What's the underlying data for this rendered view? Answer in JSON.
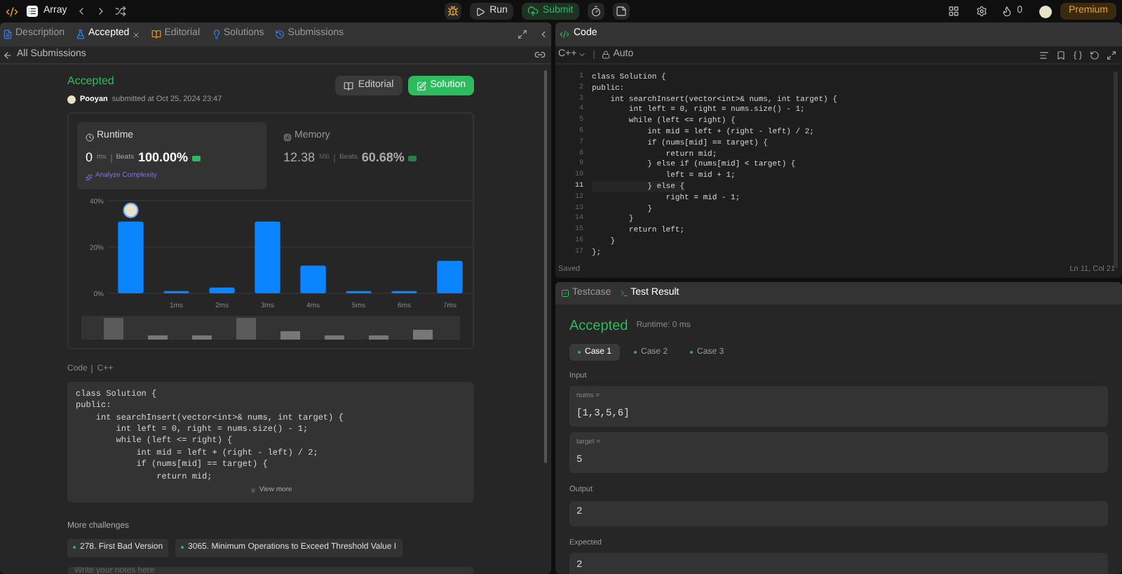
{
  "top_bar": {
    "problem_list": "Array",
    "run": "Run",
    "submit": "Submit",
    "streak": "0",
    "premium": "Premium"
  },
  "left_tabs": [
    {
      "label": "Description",
      "selected": false,
      "closable": false
    },
    {
      "label": "Accepted",
      "selected": true,
      "closable": true
    },
    {
      "label": "Editorial",
      "selected": false,
      "closable": false
    },
    {
      "label": "Solutions",
      "selected": false,
      "closable": false
    },
    {
      "label": "Submissions",
      "selected": false,
      "closable": false
    }
  ],
  "back_link": "All Submissions",
  "submission": {
    "status": "Accepted",
    "user": "Pooyan",
    "submitted_at": "submitted at Oct 25, 2024 23:47",
    "editorial_button": "Editorial",
    "solution_button": "Solution"
  },
  "stats": [
    {
      "title": "Runtime",
      "value": "0",
      "unit": "ms",
      "beats_label": "Beats",
      "beats": "100.00%",
      "selected": true,
      "extra": "Analyze Complexity"
    },
    {
      "title": "Memory",
      "value": "12.38",
      "unit": "MB",
      "beats_label": "Beats",
      "beats": "60.68%",
      "selected": false
    }
  ],
  "chart": {
    "chart_data": {
      "type": "bar",
      "categories": [
        null,
        "1ms",
        "2ms",
        "3ms",
        "4ms",
        "5ms",
        "6ms",
        "7ms"
      ],
      "values": [
        31,
        1,
        2.5,
        31,
        12,
        1,
        1,
        14
      ],
      "ylim": [
        0,
        40
      ],
      "yticks": [
        {
          "value": 0,
          "label": "0%"
        },
        {
          "value": 20,
          "label": "20%"
        },
        {
          "value": 40,
          "label": "40%"
        }
      ]
    }
  },
  "code_preview": {
    "label": "Code",
    "language": "C++",
    "lines": [
      "class Solution {",
      "public:",
      "    int searchInsert(vector<int>& nums, int target) {",
      "        int left = 0, right = nums.size() - 1;",
      "        while (left <= right) {",
      "            int mid = left + (right - left) / 2;",
      "            if (nums[mid] == target) {",
      "                return mid;"
    ],
    "view_more": "View more"
  },
  "more_challenges": {
    "title": "More challenges",
    "items": [
      "278. First Bad Version",
      "3065. Minimum Operations to Exceed Threshold Value I"
    ]
  },
  "notes": {
    "placeholder": "Write your notes here"
  },
  "editor": {
    "title": "Code",
    "language": "C++",
    "mode": "Auto",
    "lines": [
      {
        "number": "1",
        "text": "class Solution {",
        "active": false
      },
      {
        "number": "2",
        "text": "public:",
        "active": false
      },
      {
        "number": "3",
        "text": "    int searchInsert(vector<int>& nums, int target) {",
        "active": false
      },
      {
        "number": "4",
        "text": "        int left = 0, right = nums.size() - 1;",
        "active": false
      },
      {
        "number": "5",
        "text": "        while (left <= right) {",
        "active": false
      },
      {
        "number": "6",
        "text": "            int mid = left + (right - left) / 2;",
        "active": false
      },
      {
        "number": "7",
        "text": "            if (nums[mid] == target) {",
        "active": false
      },
      {
        "number": "8",
        "text": "                return mid;",
        "active": false
      },
      {
        "number": "9",
        "text": "            } else if (nums[mid] < target) {",
        "active": false
      },
      {
        "number": "10",
        "text": "                left = mid + 1;",
        "active": false
      },
      {
        "number": "11",
        "text": "            } else {",
        "active": true
      },
      {
        "number": "12",
        "text": "                right = mid - 1;",
        "active": false
      },
      {
        "number": "13",
        "text": "            }",
        "active": false
      },
      {
        "number": "14",
        "text": "        }",
        "active": false
      },
      {
        "number": "15",
        "text": "        return left;",
        "active": false
      },
      {
        "number": "16",
        "text": "    }",
        "active": false
      },
      {
        "number": "17",
        "text": "};",
        "active": false
      }
    ],
    "saved": "Saved",
    "cursor": "Ln 11, Col 21"
  },
  "result_tabs": [
    {
      "label": "Testcase",
      "selected": false
    },
    {
      "label": "Test Result",
      "selected": true
    }
  ],
  "result": {
    "status": "Accepted",
    "runtime": "Runtime: 0 ms",
    "cases": [
      {
        "label": "Case 1",
        "selected": true
      },
      {
        "label": "Case 2",
        "selected": false
      },
      {
        "label": "Case 3",
        "selected": false
      }
    ],
    "input_label": "Input",
    "inputs": [
      {
        "name": "nums =",
        "value": "[1,3,5,6]"
      },
      {
        "name": "target =",
        "value": "5"
      }
    ],
    "output_label": "Output",
    "output": "2",
    "expected_label": "Expected",
    "expected": "2"
  }
}
